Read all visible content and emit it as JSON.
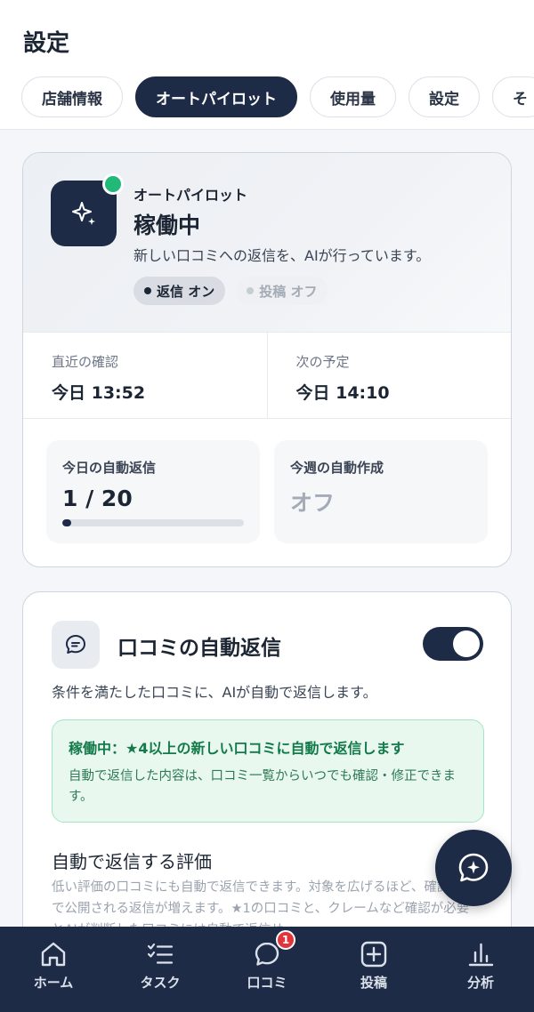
{
  "header": {
    "title": "設定",
    "tabs": [
      {
        "label": "店舗情報",
        "active": false
      },
      {
        "label": "オートパイロット",
        "active": true
      },
      {
        "label": "使用量",
        "active": false
      },
      {
        "label": "設定",
        "active": false
      },
      {
        "label": "そ",
        "active": false
      }
    ]
  },
  "autopilot": {
    "label": "オートパイロット",
    "status": "稼働中",
    "description": "新しい口コミへの返信を、AIが行っています。",
    "badges": {
      "reply": "返信 オン",
      "post": "投稿 オフ"
    },
    "last_check": {
      "label": "直近の確認",
      "value": "今日 13:52"
    },
    "next_schedule": {
      "label": "次の予定",
      "value": "今日 14:10"
    },
    "today_replies": {
      "label": "今日の自動返信",
      "value": "1 / 20",
      "progress": 0.05
    },
    "week_creation": {
      "label": "今週の自動作成",
      "value": "オフ"
    }
  },
  "auto_reply": {
    "title": "口コミの自動返信",
    "enabled": true,
    "description": "条件を満たした口コミに、AIが自動で返信します。",
    "notice_head": "稼働中：★4以上の新しい口コミに自動で返信します",
    "notice_body": "自動で返信した内容は、口コミ一覧からいつでも確認・修正できます。",
    "rating_title": "自動で返信する評価",
    "rating_desc": "低い評価の口コミにも自動で返信できます。対象を広げるほど、確認なしで公開される返信が増えます。★1の口コミと、クレームなど確認が必要とAIが判断した口コミには自動で返信せ"
  },
  "bottom_nav": {
    "items": [
      {
        "label": "ホーム",
        "icon": "home-icon"
      },
      {
        "label": "タスク",
        "icon": "task-list-icon"
      },
      {
        "label": "口コミ",
        "icon": "chat-bubble-icon",
        "badge": "1"
      },
      {
        "label": "投稿",
        "icon": "plus-square-icon"
      },
      {
        "label": "分析",
        "icon": "bar-chart-icon"
      }
    ]
  },
  "colors": {
    "navy": "#1d2b47",
    "green": "#21b87a",
    "badge_red": "#e0353b"
  }
}
